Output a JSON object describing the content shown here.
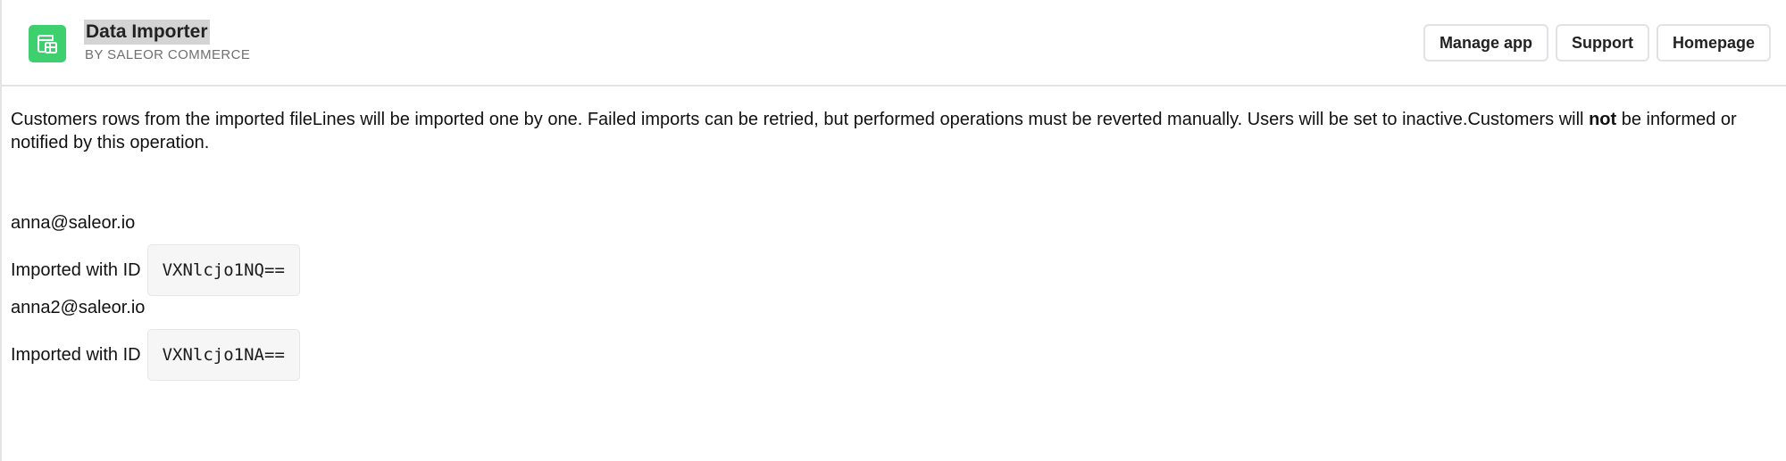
{
  "header": {
    "title": "Data Importer",
    "subtitle": "BY SALEOR COMMERCE",
    "icon": "table-import-icon",
    "accent_color": "#3ecf6e",
    "buttons": {
      "manage": "Manage app",
      "support": "Support",
      "homepage": "Homepage"
    }
  },
  "main": {
    "intro_text": "Customers rows from the imported fileLines will be imported one by one. Failed imports can be retried, but performed operations must be reverted manually. Users will be set to inactive.Customers will ",
    "intro_bold": "not",
    "intro_tail": " be informed or notified by this operation.",
    "entries": [
      {
        "email": "anna@saleor.io",
        "label": "Imported with ID",
        "id": "VXNlcjo1NQ=="
      },
      {
        "email": "anna2@saleor.io",
        "label": "Imported with ID",
        "id": "VXNlcjo1NA=="
      }
    ]
  }
}
